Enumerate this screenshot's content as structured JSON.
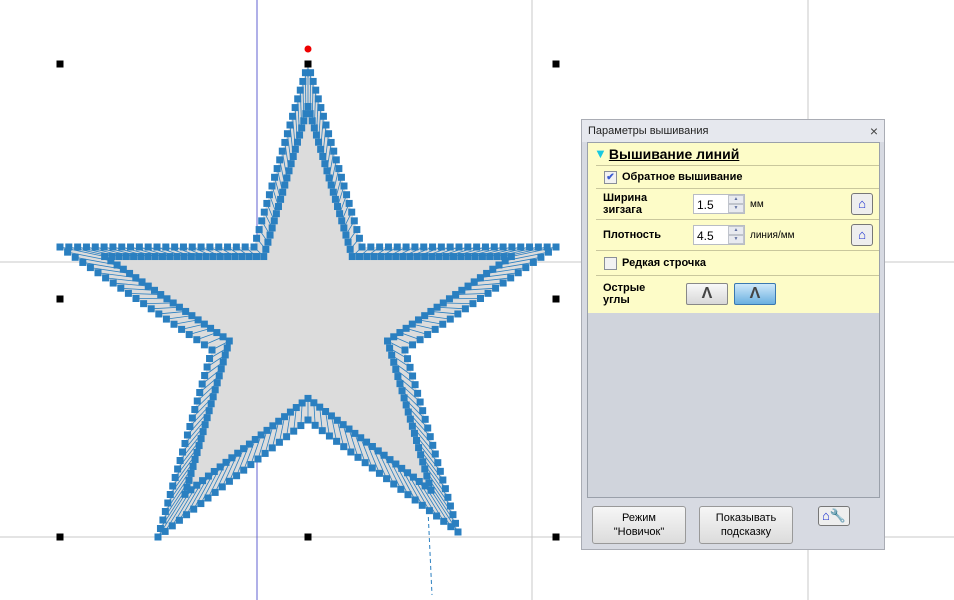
{
  "panel": {
    "title": "Параметры вышивания",
    "close": "×",
    "section": {
      "title": "Вышивание линий",
      "icon": "triangle-down-icon"
    },
    "reverse": {
      "label": "Обратное вышивание",
      "checked": true
    },
    "width": {
      "label1": "Ширина",
      "label2": "зигзага",
      "value": "1.5",
      "unit": "мм"
    },
    "density": {
      "label": "Плотность",
      "value": "4.5",
      "unit": "линия/мм"
    },
    "sparse": {
      "label": "Редкая строчка",
      "checked": false
    },
    "corners": {
      "label1": "Острые",
      "label2": "углы",
      "selected": 1
    },
    "buttons": {
      "novice1": "Режим",
      "novice2": "\"Новичок\"",
      "hint1": "Показывать",
      "hint2": "подсказку"
    }
  },
  "colors": {
    "stitch": "#2a7fc0",
    "accent": "#18c8e0",
    "panel_bg": "#fdfcc8"
  }
}
